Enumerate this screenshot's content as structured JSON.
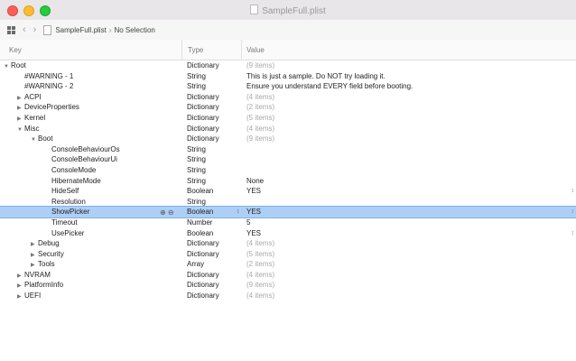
{
  "window": {
    "title": "SampleFull.plist"
  },
  "pathbar": {
    "file": "SampleFull.plist",
    "selection": "No Selection"
  },
  "columns": {
    "key": "Key",
    "type": "Type",
    "value": "Value"
  },
  "rows": [
    {
      "key": "Root",
      "indent": 0,
      "disclosure": "open",
      "type": "Dictionary",
      "value": "(9 items)",
      "muted": true
    },
    {
      "key": "#WARNING - 1",
      "indent": 1,
      "disclosure": "none",
      "type": "String",
      "value": "This is just a sample. Do NOT try loading it.",
      "muted": false
    },
    {
      "key": "#WARNING - 2",
      "indent": 1,
      "disclosure": "none",
      "type": "String",
      "value": "Ensure you understand EVERY field before booting.",
      "muted": false
    },
    {
      "key": "ACPI",
      "indent": 1,
      "disclosure": "closed",
      "type": "Dictionary",
      "value": "(4 items)",
      "muted": true
    },
    {
      "key": "DeviceProperties",
      "indent": 1,
      "disclosure": "closed",
      "type": "Dictionary",
      "value": "(2 items)",
      "muted": true
    },
    {
      "key": "Kernel",
      "indent": 1,
      "disclosure": "closed",
      "type": "Dictionary",
      "value": "(5 items)",
      "muted": true
    },
    {
      "key": "Misc",
      "indent": 1,
      "disclosure": "open",
      "type": "Dictionary",
      "value": "(4 items)",
      "muted": true
    },
    {
      "key": "Boot",
      "indent": 2,
      "disclosure": "open",
      "type": "Dictionary",
      "value": "(9 items)",
      "muted": true
    },
    {
      "key": "ConsoleBehaviourOs",
      "indent": 3,
      "disclosure": "none",
      "type": "String",
      "value": "",
      "muted": false
    },
    {
      "key": "ConsoleBehaviourUi",
      "indent": 3,
      "disclosure": "none",
      "type": "String",
      "value": "",
      "muted": false
    },
    {
      "key": "ConsoleMode",
      "indent": 3,
      "disclosure": "none",
      "type": "String",
      "value": "",
      "muted": false
    },
    {
      "key": "HibernateMode",
      "indent": 3,
      "disclosure": "none",
      "type": "String",
      "value": "None",
      "muted": false
    },
    {
      "key": "HideSelf",
      "indent": 3,
      "disclosure": "none",
      "type": "Boolean",
      "value": "YES",
      "muted": false,
      "stepper": true
    },
    {
      "key": "Resolution",
      "indent": 3,
      "disclosure": "none",
      "type": "String",
      "value": "",
      "muted": false
    },
    {
      "key": "ShowPicker",
      "indent": 3,
      "disclosure": "none",
      "type": "Boolean",
      "value": "YES",
      "muted": false,
      "selected": true,
      "stepper": true
    },
    {
      "key": "Timeout",
      "indent": 3,
      "disclosure": "none",
      "type": "Number",
      "value": "5",
      "muted": false
    },
    {
      "key": "UsePicker",
      "indent": 3,
      "disclosure": "none",
      "type": "Boolean",
      "value": "YES",
      "muted": false,
      "stepper": true
    },
    {
      "key": "Debug",
      "indent": 2,
      "disclosure": "closed",
      "type": "Dictionary",
      "value": "(4 items)",
      "muted": true
    },
    {
      "key": "Security",
      "indent": 2,
      "disclosure": "closed",
      "type": "Dictionary",
      "value": "(5 items)",
      "muted": true
    },
    {
      "key": "Tools",
      "indent": 2,
      "disclosure": "closed",
      "type": "Array",
      "value": "(2 items)",
      "muted": true
    },
    {
      "key": "NVRAM",
      "indent": 1,
      "disclosure": "closed",
      "type": "Dictionary",
      "value": "(4 items)",
      "muted": true
    },
    {
      "key": "PlatformInfo",
      "indent": 1,
      "disclosure": "closed",
      "type": "Dictionary",
      "value": "(9 items)",
      "muted": true
    },
    {
      "key": "UEFI",
      "indent": 1,
      "disclosure": "closed",
      "type": "Dictionary",
      "value": "(4 items)",
      "muted": true
    }
  ]
}
